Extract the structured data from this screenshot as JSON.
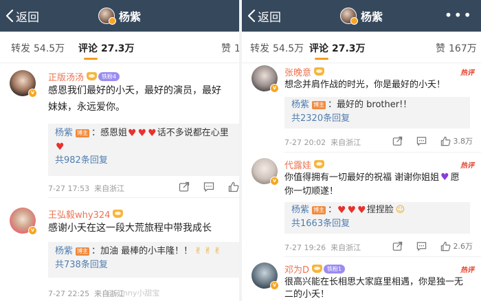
{
  "left": {
    "back_label": "返回",
    "title": "杨紫",
    "tabs": [
      {
        "label": "转发",
        "count": "54.5万"
      },
      {
        "label": "评论",
        "count": "27.3万"
      },
      {
        "label": "赞",
        "count": "1"
      }
    ],
    "comments": [
      {
        "name": "正版汤汤",
        "fan_badge": "铁粉4",
        "text_lines": [
          "感恩我们最好的小夭，最好的演员，最好",
          "妹妹，永远爱你。"
        ],
        "reply_name": "杨紫",
        "reply_badge": "博主",
        "reply_text": "：感恩姐",
        "reply_text2": "话不多说都在心里",
        "reply_count": "共982条回复",
        "time": "7-27 17:53",
        "location": "来自浙江"
      },
      {
        "name": "王弘毅why324",
        "text_lines": [
          "感谢小夭在这一段大荒旅程中带我成长"
        ],
        "reply_name": "杨紫",
        "reply_badge": "博主",
        "reply_text": "：加油 最棒的小丰隆！！",
        "reply_count": "共738条回复",
        "time": "7-27 22:25",
        "location": "来自浙江"
      }
    ],
    "watermark": "@Sunny小甜宝"
  },
  "right": {
    "back_label": "返回",
    "title": "杨紫",
    "more": "•••",
    "tabs": [
      {
        "label": "转发",
        "count": "54.5万"
      },
      {
        "label": "评论",
        "count": "27.3万"
      },
      {
        "label": "赞",
        "count": "167万"
      }
    ],
    "comments": [
      {
        "name": "张晚意",
        "hot_badge": "热评",
        "text_lines": [
          "想念并肩作战的时光，你是最好的小夭！"
        ],
        "reply_name": "杨紫",
        "reply_badge": "博主",
        "reply_text": "：最好的 brother!！",
        "reply_count": "共2320条回复",
        "time": "7-27 20:02",
        "location": "来自浙江",
        "likes": "3.8万"
      },
      {
        "name": "代露娃",
        "hot_badge": "热评",
        "text_lines": [
          "你值得拥有一切最好的祝福 谢谢你姐姐",
          "你一切顺遂！"
        ],
        "text_after_heart": "愿",
        "reply_name": "杨紫",
        "reply_badge": "博主",
        "reply_text": "：",
        "reply_text2": "捏捏脸",
        "reply_count": "共1663条回复",
        "time": "7-27 19:26",
        "location": "来自浙江",
        "likes": "2.6万"
      },
      {
        "name": "邓为D",
        "fan_badge": "铁粉1",
        "hot_badge": "热评",
        "text_lines": [
          "很高兴能在长相思大家庭里相遇，你是独一无",
          "二的小夭！"
        ]
      }
    ]
  },
  "colors": {
    "topbar": "#36485c",
    "accent_orange": "#f29b1f",
    "username": "#eb7350",
    "link_blue": "#507daf",
    "hot_red": "#e8412c"
  }
}
